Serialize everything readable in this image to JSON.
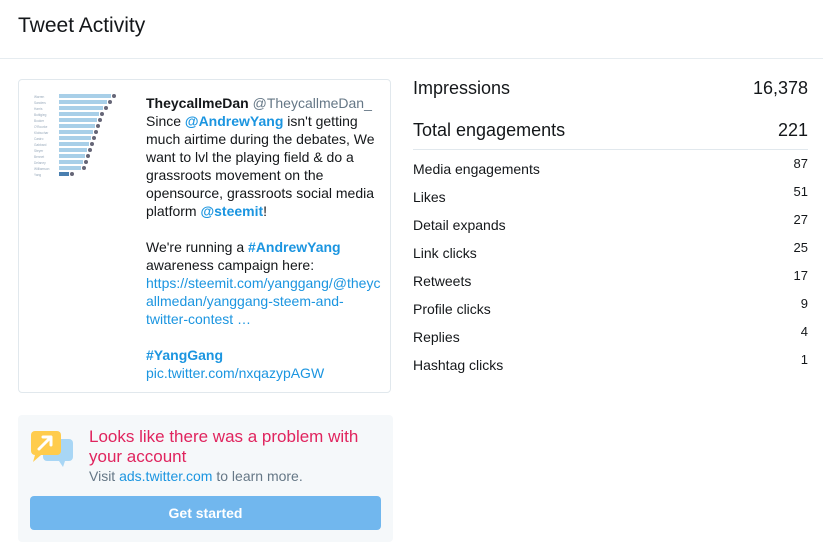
{
  "header": {
    "title": "Tweet Activity"
  },
  "tweet": {
    "author_name": "TheycallmeDan",
    "author_handle": "@TheycallmeDan_",
    "line1_a": "Since ",
    "mention1": "@AndrewYang",
    "line1_b": " isn't getting",
    "line2": "much airtime during the debates, We",
    "line3": "want to lvl the playing field & do a",
    "line4": "grassroots movement on the",
    "line5": "opensource, grassroots social media",
    "line6_a": "platform ",
    "mention2": "@steemit",
    "line6_b": "!",
    "line7_a": "We're running a ",
    "hashtag1": "#AndrewYang",
    "line8": "awareness campaign here:",
    "link1": "https://steemit.com/yanggang/@theyc",
    "link2": "allmedan/yanggang-steem-and-",
    "link3": "twitter-contest …",
    "hashtag2": "#YangGang",
    "link4": "pic.twitter.com/nxqazypAGW"
  },
  "ad": {
    "title": "Looks like there was a problem with your account",
    "sub_prefix": "Visit ",
    "sub_link": "ads.twitter.com",
    "sub_suffix": " to learn more.",
    "button_label": "Get started"
  },
  "metrics": {
    "impressions_label": "Impressions",
    "impressions_value": "16,378",
    "engagements_label": "Total engagements",
    "engagements_value": "221",
    "rows": [
      {
        "label": "Media engagements",
        "value": "87"
      },
      {
        "label": "Likes",
        "value": "51"
      },
      {
        "label": "Detail expands",
        "value": "27"
      },
      {
        "label": "Link clicks",
        "value": "25"
      },
      {
        "label": "Retweets",
        "value": "17"
      },
      {
        "label": "Profile clicks",
        "value": "9"
      },
      {
        "label": "Replies",
        "value": "4"
      },
      {
        "label": "Hashtag clicks",
        "value": "1"
      }
    ]
  },
  "colors": {
    "accent": "#1b95e0",
    "alert": "#e0245e",
    "button": "#71b7ee",
    "panel": "#f5f8fa"
  },
  "icons": {
    "ad_icon": "megaphone-arrow-icon"
  }
}
